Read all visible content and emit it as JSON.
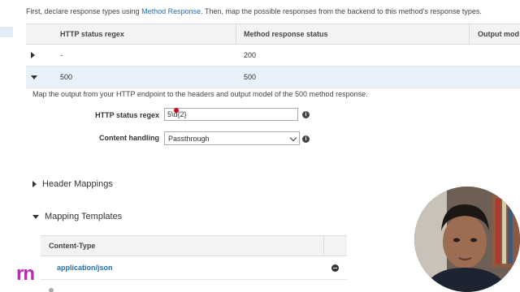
{
  "intro": {
    "text_before": "First, declare response types using ",
    "link": "Method Response",
    "text_after": ". Then, map the possible responses from the backend to this method's response types."
  },
  "table": {
    "headers": [
      "HTTP status regex",
      "Method response status",
      "Output mod"
    ],
    "rows": [
      {
        "regex": "-",
        "status": "200",
        "expanded": false
      },
      {
        "regex": "500",
        "status": "500",
        "expanded": true
      }
    ]
  },
  "detail": {
    "description": "Map the output from your HTTP endpoint to the headers and output model of the 500 method response.",
    "regex_label": "HTTP status regex",
    "regex_value": "5\\d{2}",
    "content_label": "Content handling",
    "content_value": "Passthrough"
  },
  "sections": {
    "header_mappings": "Header Mappings",
    "mapping_templates": "Mapping Templates"
  },
  "content_types": {
    "header": "Content-Type",
    "rows": [
      "application/json"
    ]
  },
  "logo": "rn",
  "colors": {
    "link": "#1f6fb5",
    "selected_row": "#e8f1f9",
    "logo": "#b12fb0"
  }
}
